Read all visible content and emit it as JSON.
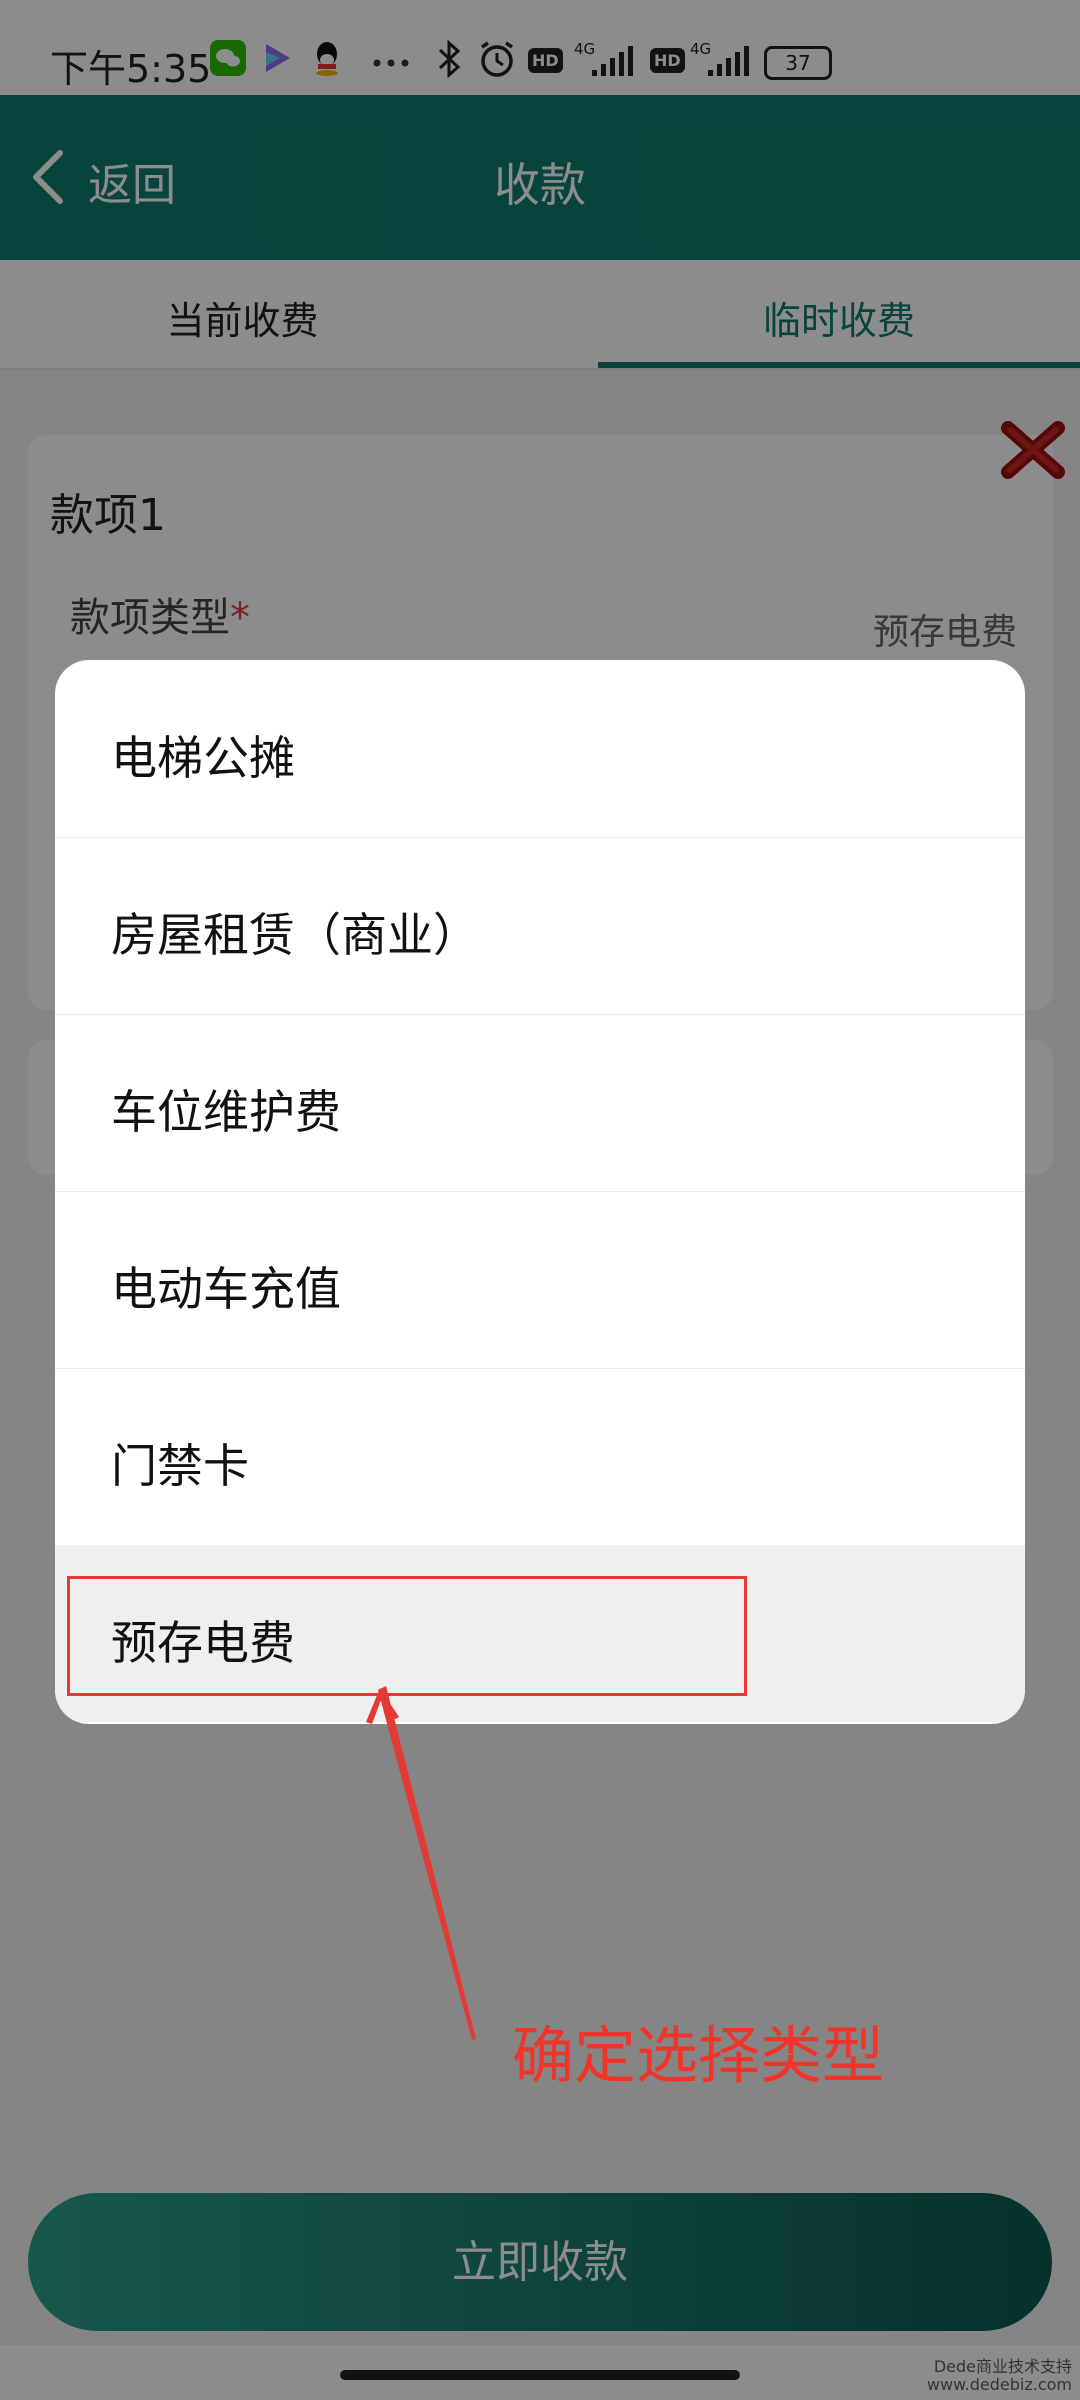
{
  "status_bar": {
    "time": "下午5:35",
    "hd1": "HD",
    "hd2": "HD",
    "net1": "4G",
    "net2": "4G",
    "battery": "37"
  },
  "header": {
    "back_label": "返回",
    "title": "收款"
  },
  "tabs": [
    {
      "label": "当前收费",
      "active": false
    },
    {
      "label": "临时收费",
      "active": true
    }
  ],
  "card": {
    "title": "款项1",
    "field_label": "款项类型",
    "required_mark": "*",
    "field_value": "预存电费"
  },
  "sheet": {
    "options": [
      {
        "label": "电梯公摊",
        "selected": false
      },
      {
        "label": "房屋租赁（商业）",
        "selected": false
      },
      {
        "label": "车位维护费",
        "selected": false
      },
      {
        "label": "电动车充值",
        "selected": false
      },
      {
        "label": "门禁卡",
        "selected": false
      },
      {
        "label": "预存电费",
        "selected": true
      }
    ]
  },
  "annotation": {
    "text": "确定选择类型"
  },
  "footer": {
    "pay_button": "立即收款"
  },
  "watermark": {
    "line1": "Dede商业技术支持",
    "line2": "www.dedebiz.com"
  },
  "colors": {
    "primary": "#0f7d70",
    "annotation_red": "#e53935",
    "delete_red": "#9b1010"
  }
}
